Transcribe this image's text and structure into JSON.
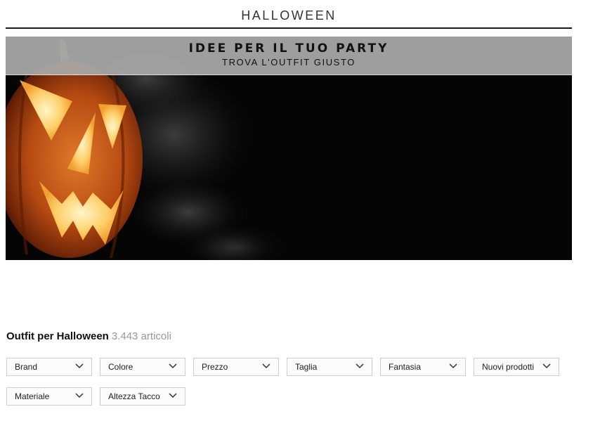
{
  "page": {
    "title": "HALLOWEEN"
  },
  "banner": {
    "heading": "IDEE PER IL TUO PARTY",
    "subheading": "TROVA L'OUTFIT GIUSTO",
    "image": "jack-o-lantern pumpkin with smoke on black background"
  },
  "results": {
    "title": "Outfit per Halloween",
    "count": "3.443 articoli"
  },
  "filters": [
    {
      "label": "Brand",
      "icon": "chevron-down-icon"
    },
    {
      "label": "Colore",
      "icon": "chevron-down-icon"
    },
    {
      "label": "Prezzo",
      "icon": "chevron-down-icon"
    },
    {
      "label": "Taglia",
      "icon": "chevron-down-icon"
    },
    {
      "label": "Fantasia",
      "icon": "chevron-down-icon"
    },
    {
      "label": "Nuovi prodotti",
      "icon": "chevron-down-icon"
    },
    {
      "label": "Materiale",
      "icon": "chevron-down-icon"
    },
    {
      "label": "Altezza Tacco",
      "icon": "chevron-down-icon"
    }
  ],
  "colors": {
    "banner_band": "#aaaaaa",
    "hero_background": "#050505",
    "pumpkin": "#d2691e",
    "pumpkin_glow": "#ffd27a",
    "count_text": "#9a9a9a",
    "filter_border": "#cfcfcf"
  }
}
